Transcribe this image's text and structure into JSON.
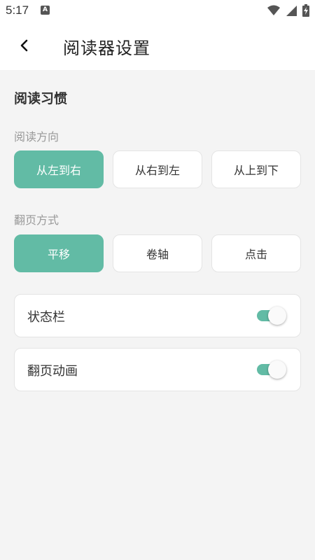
{
  "status_bar": {
    "time": "5:17",
    "notification_letter": "A",
    "icons": [
      "wifi-icon",
      "signal-icon",
      "battery-charging-icon"
    ]
  },
  "header": {
    "back_icon": "chevron-left-icon",
    "title": "阅读器设置"
  },
  "reading_habits": {
    "title": "阅读习惯",
    "direction": {
      "label": "阅读方向",
      "options": [
        "从左到右",
        "从右到左",
        "从上到下"
      ],
      "selected": "从左到右"
    },
    "page_turn": {
      "label": "翻页方式",
      "options": [
        "平移",
        "卷轴",
        "点击"
      ],
      "selected": "平移"
    },
    "toggles": [
      {
        "label": "状态栏",
        "on": true
      },
      {
        "label": "翻页动画",
        "on": true
      }
    ]
  },
  "colors": {
    "accent": "#62bba5",
    "background": "#f4f4f4",
    "card": "#ffffff"
  }
}
